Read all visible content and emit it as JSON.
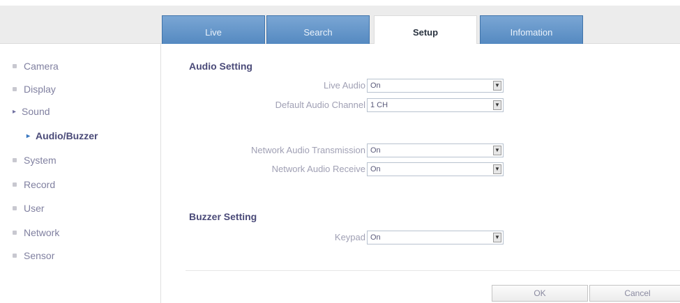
{
  "tabs": [
    {
      "label": "Live"
    },
    {
      "label": "Search"
    },
    {
      "label": "Setup"
    },
    {
      "label": "Infomation"
    }
  ],
  "sidebar": {
    "items": [
      {
        "label": "Camera"
      },
      {
        "label": "Display"
      },
      {
        "label": "Sound"
      },
      {
        "label": "Audio/Buzzer"
      },
      {
        "label": "System"
      },
      {
        "label": "Record"
      },
      {
        "label": "User"
      },
      {
        "label": "Network"
      },
      {
        "label": "Sensor"
      }
    ]
  },
  "audio": {
    "title": "Audio Setting",
    "live_audio": {
      "label": "Live Audio",
      "value": "On"
    },
    "default_channel": {
      "label": "Default Audio Channel",
      "value": "1 CH"
    },
    "net_transmission": {
      "label": "Network Audio Transmission",
      "value": "On"
    },
    "net_receive": {
      "label": "Network Audio Receive",
      "value": "On"
    }
  },
  "buzzer": {
    "title": "Buzzer Setting",
    "keypad": {
      "label": "Keypad",
      "value": "On"
    }
  },
  "buttons": {
    "ok": "OK",
    "cancel": "Cancel"
  },
  "colors": {
    "tab_blue": "#5c8fc4",
    "text_purple": "#4a4a78"
  }
}
